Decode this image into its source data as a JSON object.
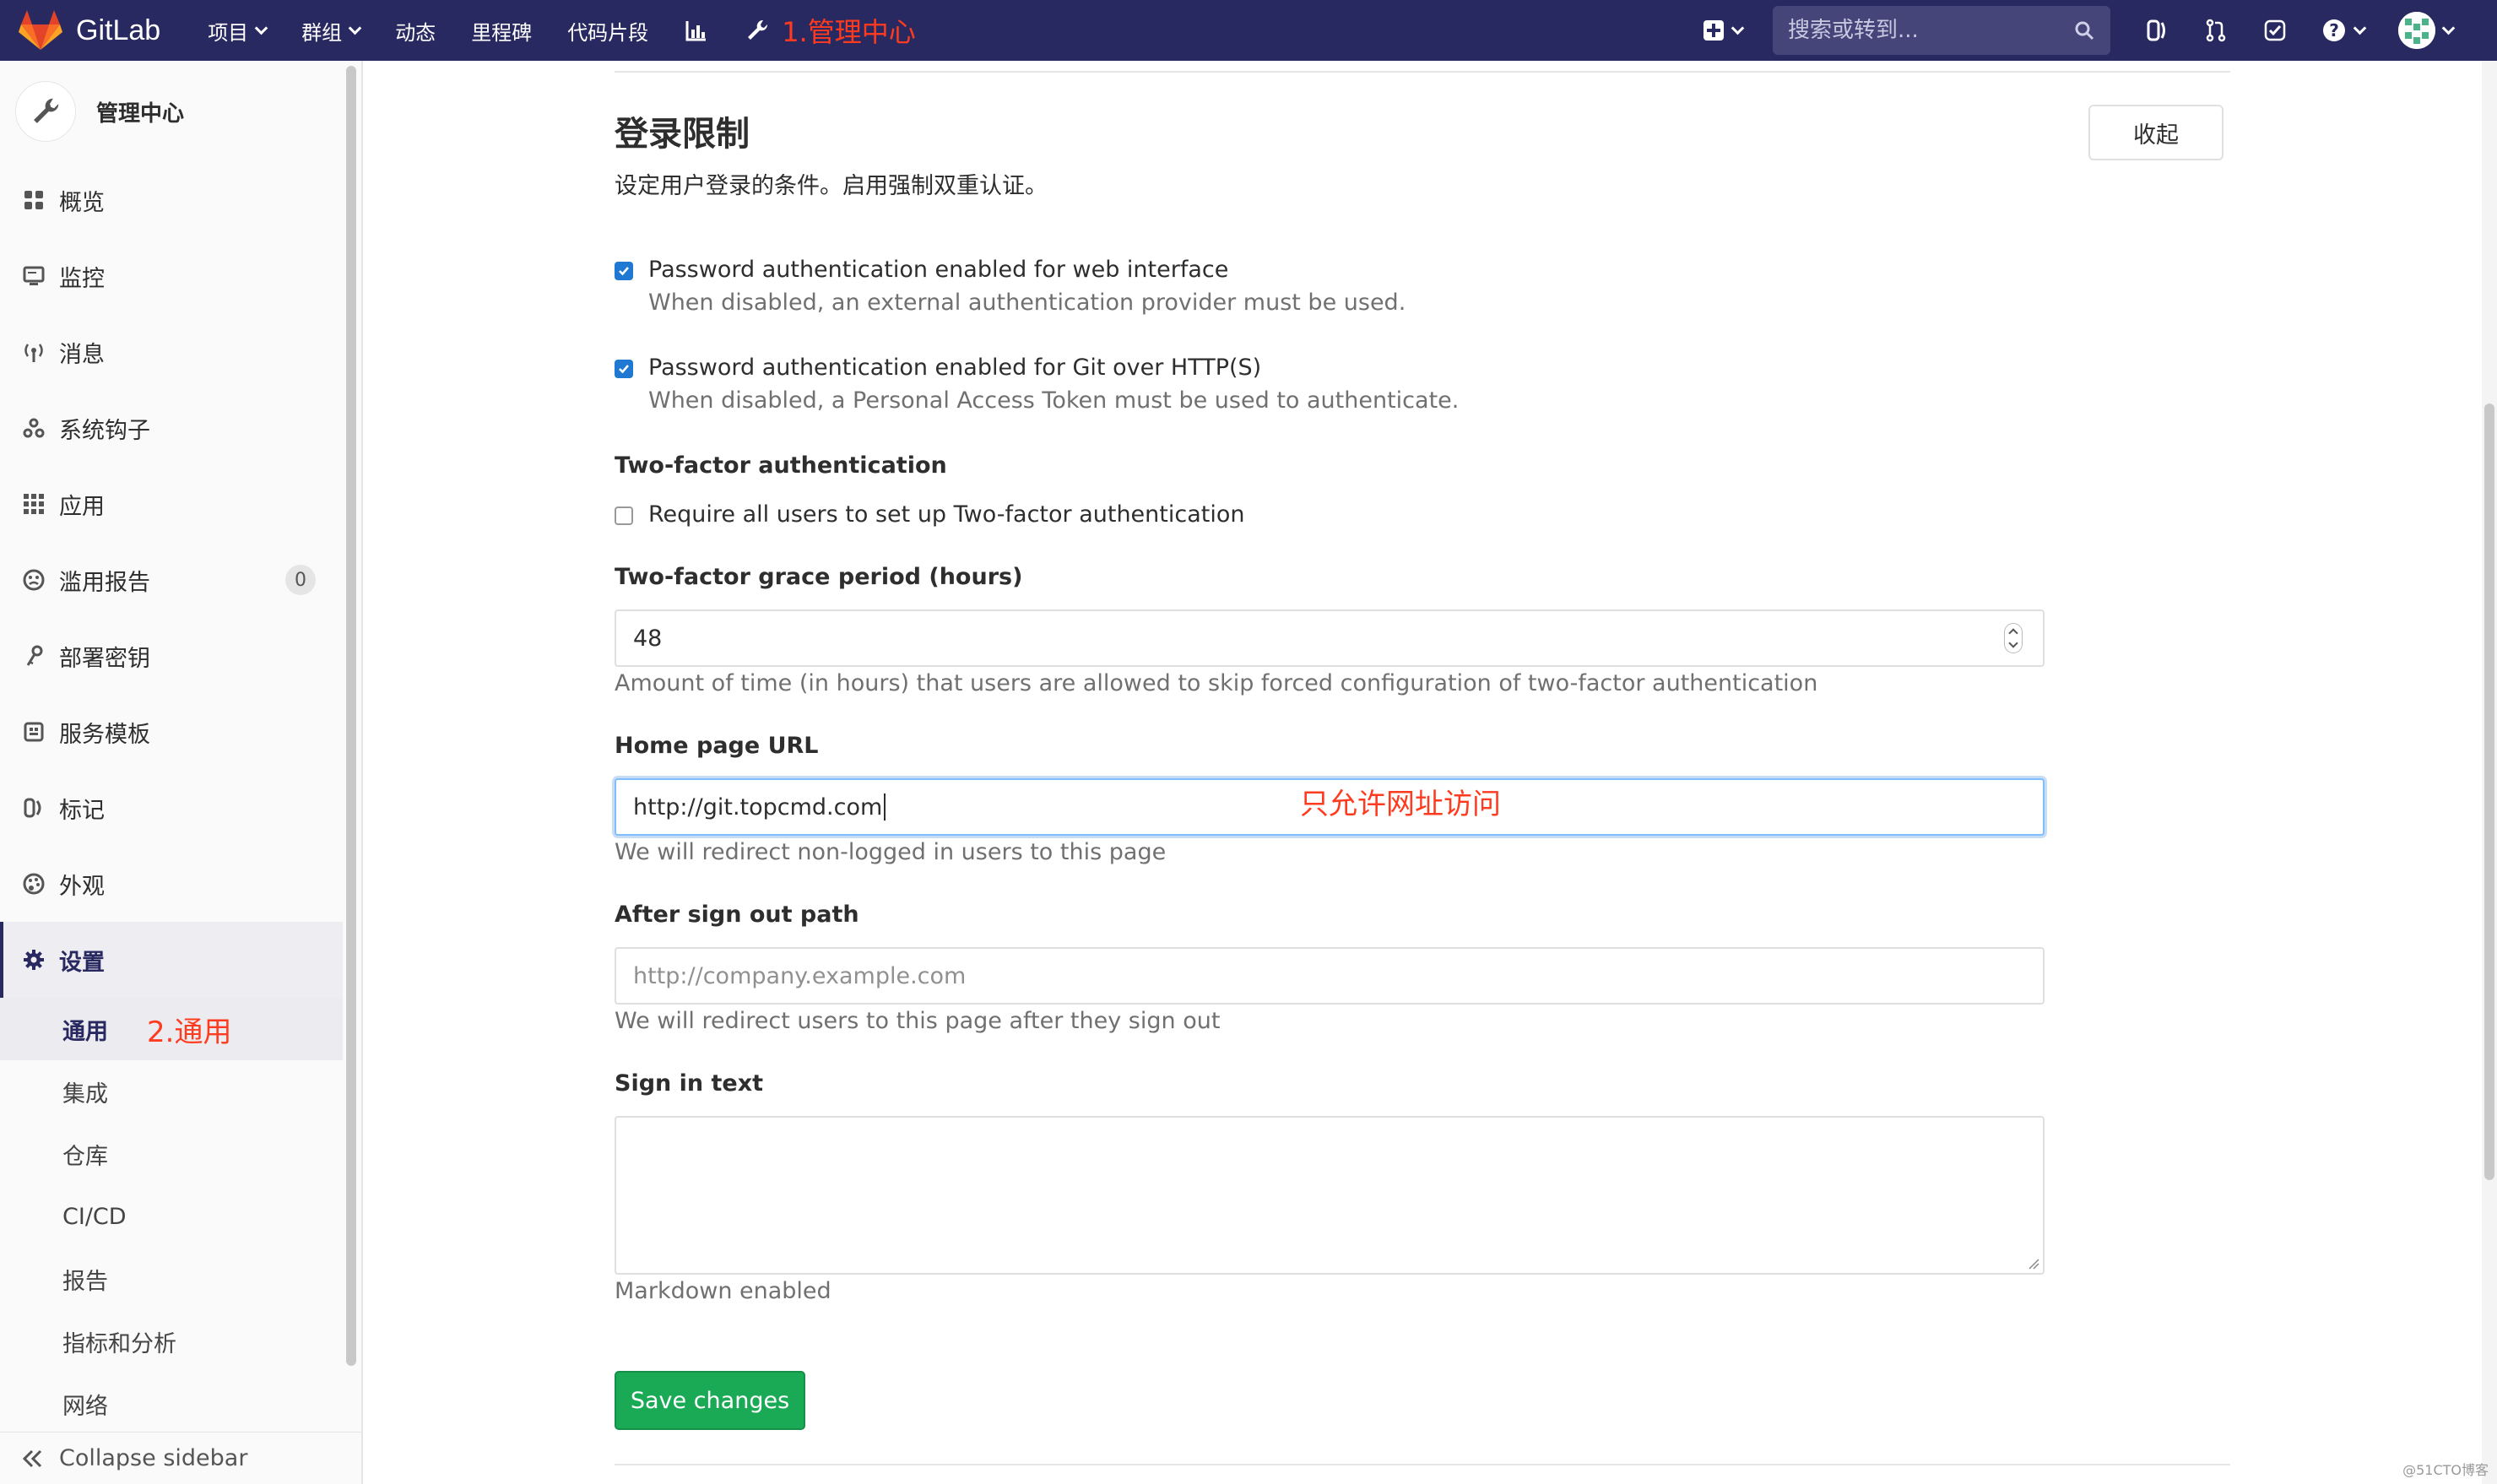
{
  "navbar": {
    "brand": "GitLab",
    "items": [
      {
        "label": "项目",
        "has_caret": true
      },
      {
        "label": "群组",
        "has_caret": true
      },
      {
        "label": "动态"
      },
      {
        "label": "里程碑"
      },
      {
        "label": "代码片段"
      }
    ],
    "annotation": "1.管理中心",
    "search_placeholder": "搜索或转到...",
    "bg_color": "#292961"
  },
  "sidebar": {
    "title": "管理中心",
    "items": [
      {
        "label": "概览",
        "icon": "overview-icon"
      },
      {
        "label": "监控",
        "icon": "monitor-icon"
      },
      {
        "label": "消息",
        "icon": "broadcast-icon"
      },
      {
        "label": "系统钩子",
        "icon": "hook-icon"
      },
      {
        "label": "应用",
        "icon": "apps-icon"
      },
      {
        "label": "滥用报告",
        "icon": "abuse-icon",
        "badge": "0"
      },
      {
        "label": "部署密钥",
        "icon": "key-icon"
      },
      {
        "label": "服务模板",
        "icon": "template-icon"
      },
      {
        "label": "标记",
        "icon": "labels-icon"
      },
      {
        "label": "外观",
        "icon": "palette-icon"
      },
      {
        "label": "设置",
        "icon": "gear-icon",
        "active": true
      }
    ],
    "settings_sub": [
      {
        "label": "通用",
        "active": true
      },
      {
        "label": "集成"
      },
      {
        "label": "仓库"
      },
      {
        "label": "CI/CD"
      },
      {
        "label": "报告"
      },
      {
        "label": "指标和分析"
      },
      {
        "label": "网络"
      }
    ],
    "annotation": "2.通用",
    "collapse_label": "Collapse sidebar"
  },
  "section": {
    "title": "登录限制",
    "description": "设定用户登录的条件。启用强制双重认证。",
    "collapse_button": "收起",
    "pw_web": {
      "label": "Password authentication enabled for web interface",
      "help": "When disabled, an external authentication provider must be used.",
      "checked": true
    },
    "pw_git": {
      "label": "Password authentication enabled for Git over HTTP(S)",
      "help": "When disabled, a Personal Access Token must be used to authenticate.",
      "checked": true
    },
    "two_factor": {
      "heading": "Two-factor authentication",
      "label": "Require all users to set up Two-factor authentication",
      "checked": false
    },
    "grace": {
      "label": "Two-factor grace period (hours)",
      "value": "48",
      "help": "Amount of time (in hours) that users are allowed to skip forced configuration of two-factor authentication"
    },
    "home_url": {
      "label": "Home page URL",
      "value": "http://git.topcmd.com",
      "annotation": "只允许网址访问",
      "help": "We will redirect non-logged in users to this page"
    },
    "sign_out": {
      "label": "After sign out path",
      "placeholder": "http://company.example.com",
      "help": "We will redirect users to this page after they sign out"
    },
    "sign_in_text": {
      "label": "Sign in text",
      "help": "Markdown enabled"
    },
    "save_label": "Save changes"
  },
  "watermark": "@51CTO博客",
  "colors": {
    "accent": "#1f78d1",
    "save": "#1aaa55",
    "annotation": "#ff3b1f"
  }
}
